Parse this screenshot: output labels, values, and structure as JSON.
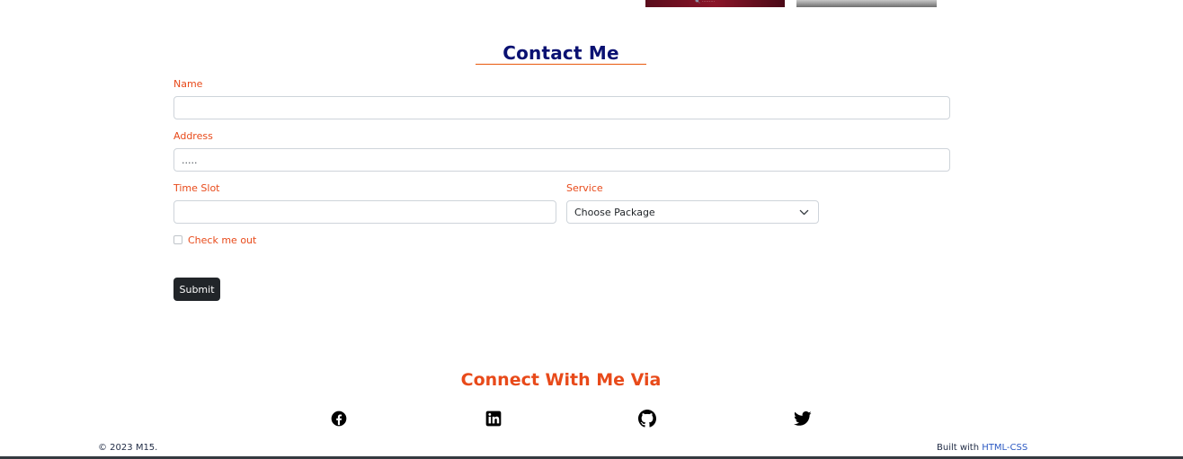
{
  "contact": {
    "title": "Contact Me",
    "name_label": "Name",
    "name_value": "",
    "address_label": "Address",
    "address_value": ".....",
    "timeslot_label": "Time Slot",
    "timeslot_value": "",
    "service_label": "Service",
    "service_selected": "Choose Package",
    "checkbox_label": "Check me out",
    "submit_label": "Submit"
  },
  "connect": {
    "title": "Connect With Me Via",
    "links": [
      {
        "icon": "facebook-icon"
      },
      {
        "icon": "linkedin-icon"
      },
      {
        "icon": "github-icon"
      },
      {
        "icon": "twitter-icon"
      }
    ]
  },
  "footer": {
    "copyright_prefix": "© 2023 ",
    "brand": "M15",
    "copyright_suffix": ".",
    "built_prefix": "Built with ",
    "built_link": "HTML-CSS"
  },
  "colors": {
    "title": "#0a1172",
    "accent": "#e84a1a",
    "button": "#212529"
  }
}
